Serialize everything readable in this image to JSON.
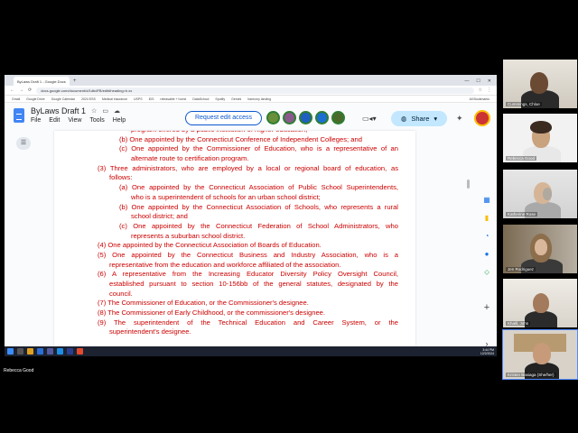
{
  "browser": {
    "tab_title": "ByLaws Draft 1 - Google Docs",
    "tab_plus": "+",
    "url": "docs.google.com/document/d/1dbdFB/edit#heading=h.xx",
    "bookmarks": [
      "Gmail",
      "Google Drive",
      "Google Calendar",
      "2024 ESS",
      "Medical insurance",
      "USPS",
      "IDS",
      "releasable + home",
      "DataSchool",
      "Spotify",
      "Gemini",
      "harmony landing",
      "All Bookmarks"
    ]
  },
  "docs": {
    "title": "ByLaws Draft 1",
    "menu": [
      "File",
      "Edit",
      "View",
      "Tools",
      "Help"
    ],
    "request_edit_label": "Request edit access",
    "share_label": "Share"
  },
  "document": {
    "lines": [
      {
        "text": "program offered by a public institution of higher education;",
        "indent": 37,
        "justify": false
      },
      {
        "text": "(b) One appointed by the Connecticut Conference of Independent Colleges; and",
        "indent": 24,
        "justify": false
      },
      {
        "text": "(c) One appointed by the Commissioner of Education, who is a representative of an",
        "indent": 24,
        "justify": true
      },
      {
        "text": "alternate route to certification program.",
        "indent": 37,
        "justify": false
      },
      {
        "text": "(3) Three administrators, who are employed by a local or regional board of education, as",
        "indent": 0,
        "justify": true
      },
      {
        "text": "follows:",
        "indent": 13,
        "justify": false
      },
      {
        "text": "(a) One appointed by the Connecticut Association of Public School Superintendents,",
        "indent": 24,
        "justify": true
      },
      {
        "text": "who is a superintendent of schools for an urban school district;",
        "indent": 37,
        "justify": false
      },
      {
        "text": "(b) One appointed by the Connecticut Association of Schools, who represents a rural",
        "indent": 24,
        "justify": true
      },
      {
        "text": "school district; and",
        "indent": 37,
        "justify": false
      },
      {
        "text": "(c) One appointed by the Connecticut Federation of School Administrators, who",
        "indent": 24,
        "justify": true
      },
      {
        "text": "represents a suburban school district.",
        "indent": 37,
        "justify": false
      },
      {
        "text": "(4) One appointed by the Connecticut Association of Boards of Education.",
        "indent": 0,
        "justify": false
      },
      {
        "text": "(5) One appointed by the Connecticut Business and Industry Association, who is a",
        "indent": 0,
        "justify": true
      },
      {
        "text": "representative from the education and workforce affiliated of the association.",
        "indent": 13,
        "justify": false
      },
      {
        "text": "(6) A representative from the Increasing Educator Diversity Policy Oversight Council,",
        "indent": 0,
        "justify": true
      },
      {
        "text": "established pursuant to section 10-156bb of the general statutes, designated by the",
        "indent": 13,
        "justify": true
      },
      {
        "text": "council.",
        "indent": 13,
        "justify": false
      },
      {
        "text": "(7) The Commissioner of Education, or the Commissioner's designee.",
        "indent": 0,
        "justify": false
      },
      {
        "text": "(8) The Commissioner of Early Childhood, or the commissioner's designee.",
        "indent": 0,
        "justify": false
      },
      {
        "text": "(9) The superintendent of the Technical Education and Career System, or the",
        "indent": 0,
        "justify": true
      },
      {
        "text": "superintendent's designee.",
        "indent": 13,
        "justify": false
      }
    ]
  },
  "taskbar": {
    "time": "3:44 PM",
    "date": "12/2/2024"
  },
  "presenter_name": "Rebecca Good",
  "participants": [
    {
      "name": "Cummings, Chloe"
    },
    {
      "name": "Rebecca Good"
    },
    {
      "name": "Katherine Rose"
    },
    {
      "name": "Jen Rodriguez"
    },
    {
      "name": "Khalil, John"
    },
    {
      "name": "Kristen Basiaga (She/her)"
    }
  ],
  "colors": {
    "doc_text": "#cc0000",
    "share_bg": "#c2e7ff",
    "accent": "#0b57d0"
  }
}
